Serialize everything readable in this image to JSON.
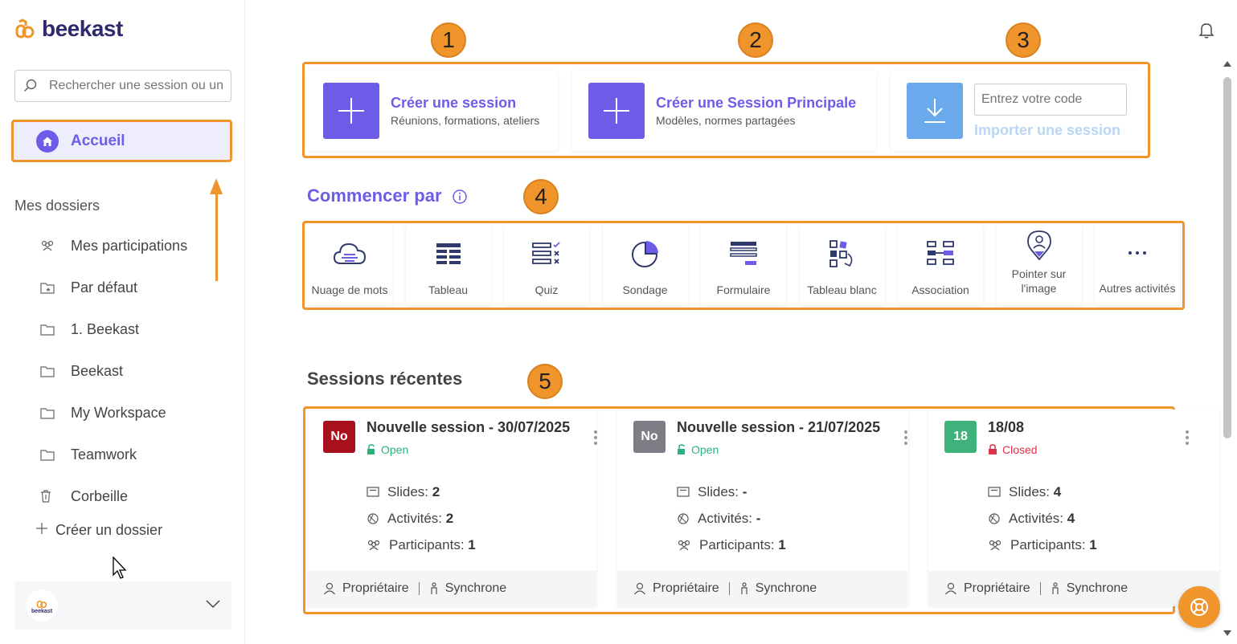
{
  "brand": {
    "name": "beekast",
    "accent": "#6c5ce7",
    "highlight": "#f0952c"
  },
  "search": {
    "placeholder": "Rechercher une session ou un"
  },
  "sidebar": {
    "home_label": "Accueil",
    "folders_title": "Mes dossiers",
    "items": [
      {
        "label": "Mes participations",
        "icon": "participants-icon"
      },
      {
        "label": "Par défaut",
        "icon": "star-folder-icon"
      },
      {
        "label": "1. Beekast",
        "icon": "folder-icon"
      },
      {
        "label": "Beekast",
        "icon": "folder-icon"
      },
      {
        "label": "My Workspace",
        "icon": "folder-icon"
      },
      {
        "label": "Teamwork",
        "icon": "folder-icon"
      },
      {
        "label": "Corbeille",
        "icon": "trash-icon"
      }
    ],
    "create_folder": "Créer un dossier",
    "account_logo_text": "beekast"
  },
  "badges": [
    "1",
    "2",
    "3",
    "4",
    "5"
  ],
  "create": {
    "session_title": "Créer une session",
    "session_sub": "Réunions, formations, ateliers",
    "main_title": "Créer une Session Principale",
    "main_sub": "Modèles, normes partagées",
    "code_placeholder": "Entrez votre code",
    "import_label": "Importer une session"
  },
  "start": {
    "title": "Commencer par",
    "activities": [
      {
        "label": "Nuage de mots",
        "icon": "cloud-icon"
      },
      {
        "label": "Tableau",
        "icon": "table-icon"
      },
      {
        "label": "Quiz",
        "icon": "quiz-icon"
      },
      {
        "label": "Sondage",
        "icon": "pie-icon"
      },
      {
        "label": "Formulaire",
        "icon": "form-icon"
      },
      {
        "label": "Tableau blanc",
        "icon": "whiteboard-icon"
      },
      {
        "label": "Association",
        "icon": "association-icon"
      },
      {
        "label": "Pointer sur l'image",
        "icon": "pin-icon"
      },
      {
        "label": "Autres activités",
        "icon": "more-icon"
      }
    ]
  },
  "recent": {
    "title": "Sessions récentes",
    "stat_labels": {
      "slides": "Slides:",
      "activities": "Activités:",
      "participants": "Participants:"
    },
    "footer": {
      "owner": "Propriétaire",
      "mode": "Synchrone"
    },
    "sessions": [
      {
        "avatar": "No",
        "avatar_color": "#a8101e",
        "title": "Nouvelle session - 30/07/2025",
        "status": "Open",
        "status_color": "#2ab27b",
        "slides": "2",
        "activities": "2",
        "participants": "1"
      },
      {
        "avatar": "No",
        "avatar_color": "#7d7d85",
        "title": "Nouvelle session - 21/07/2025",
        "status": "Open",
        "status_color": "#2ab27b",
        "slides": "-",
        "activities": "-",
        "participants": "1"
      },
      {
        "avatar": "18",
        "avatar_color": "#3fb17a",
        "title": "18/08",
        "status": "Closed",
        "status_color": "#e0314b",
        "slides": "4",
        "activities": "4",
        "participants": "1"
      }
    ]
  }
}
